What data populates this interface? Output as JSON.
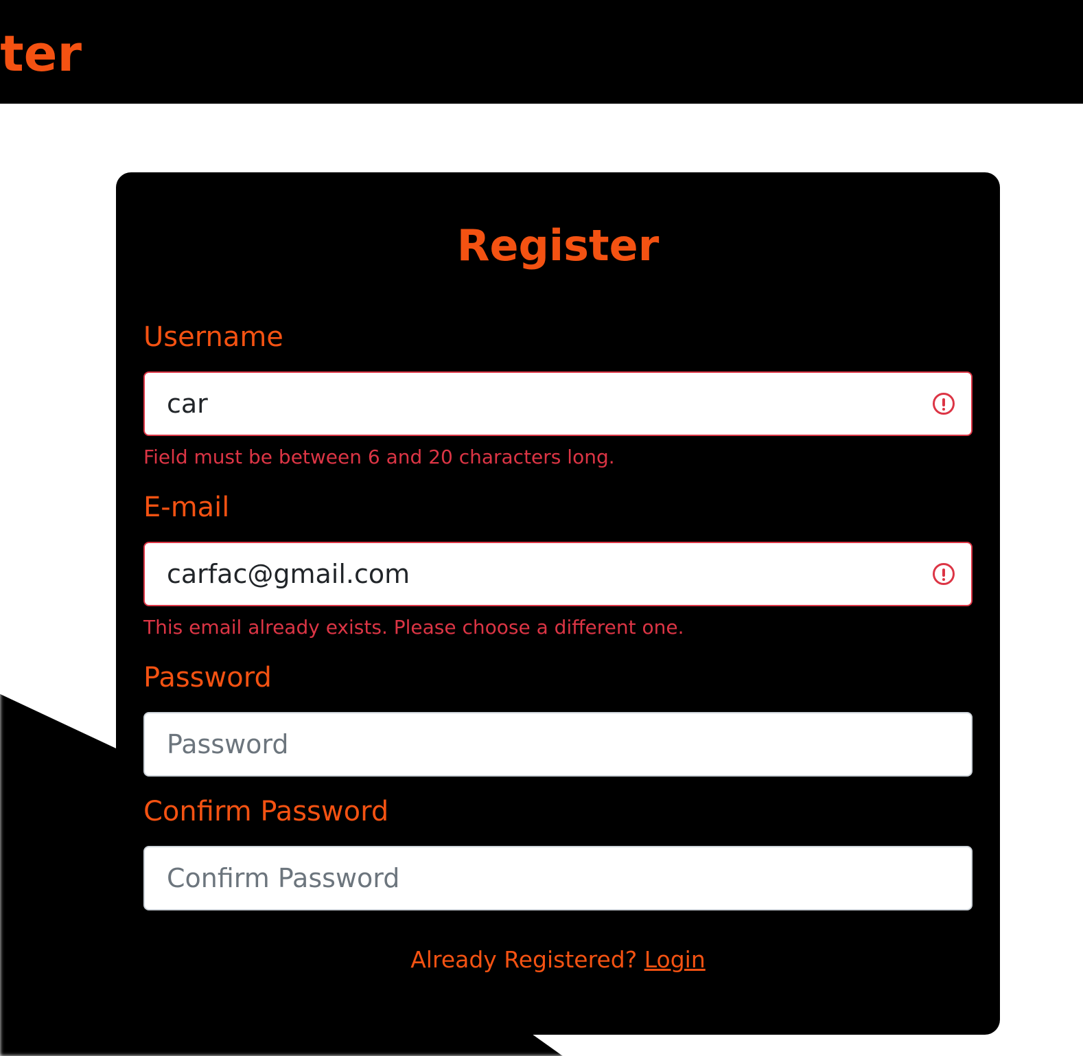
{
  "colors": {
    "accent": "#F45212",
    "error": "#DC3545",
    "card_background": "#000000",
    "header_background": "#000000"
  },
  "header": {
    "brand": "Critter"
  },
  "form": {
    "title": "Register",
    "username": {
      "label": "Username",
      "value": "car",
      "error": "Field must be between 6 and 20 characters long.",
      "status_icon": "exclamation-circle-icon"
    },
    "email": {
      "label": "E-mail",
      "value": "carfac@gmail.com",
      "error": "This email already exists. Please choose a different one.",
      "status_icon": "exclamation-circle-icon"
    },
    "password": {
      "label": "Password",
      "placeholder": "Password",
      "value": ""
    },
    "confirm_password": {
      "label": "Confirm Password",
      "placeholder": "Confirm Password",
      "value": ""
    },
    "footer": {
      "prompt": "Already Registered?",
      "login_link": "Login"
    }
  }
}
